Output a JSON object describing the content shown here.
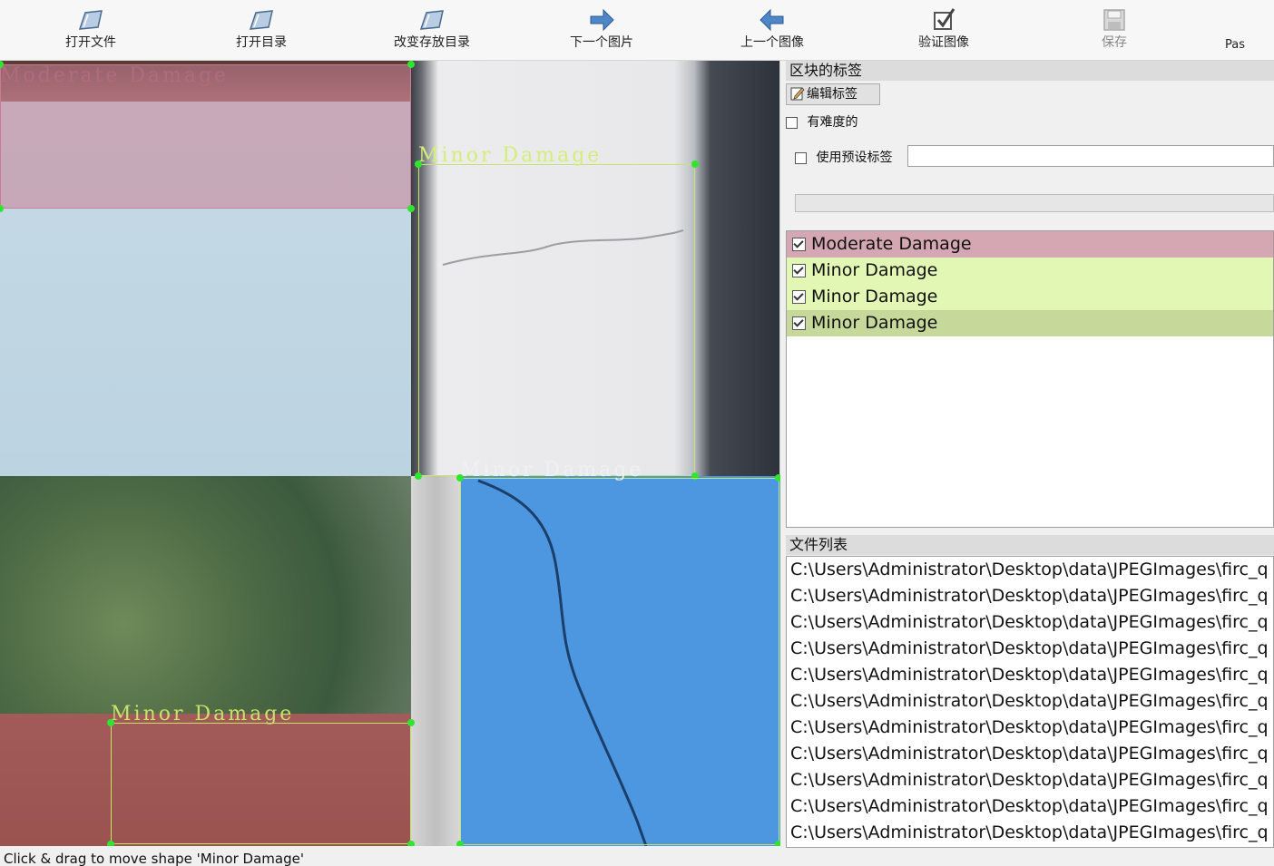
{
  "toolbar": {
    "open_file": "打开文件",
    "open_dir": "打开目录",
    "change_save_dir": "改变存放目录",
    "next_image": "下一个图片",
    "prev_image": "上一个图像",
    "verify_image": "验证图像",
    "save": "保存",
    "pascal": "Pas"
  },
  "annotations": {
    "box1": "Moderate Damage",
    "box2": "Minor Damage",
    "box3": "Minor Damage",
    "box4": "Minor Damage"
  },
  "panel": {
    "box_labels_title": "区块的标签",
    "edit_label": "编辑标签",
    "difficult": "有难度的",
    "use_default_label": "使用预设标签",
    "default_label_value": "",
    "file_list_title": "文件列表"
  },
  "labels": [
    {
      "text": "Moderate Damage",
      "checked": true,
      "color": "#d4a7b3"
    },
    {
      "text": "Minor Damage",
      "checked": true,
      "color": "#e3f7b4"
    },
    {
      "text": "Minor Damage",
      "checked": true,
      "color": "#e3f7b4"
    },
    {
      "text": "Minor Damage",
      "checked": true,
      "color": "#c6d99a"
    }
  ],
  "files": [
    "C:\\Users\\Administrator\\Desktop\\data\\JPEGImages\\firc_q",
    "C:\\Users\\Administrator\\Desktop\\data\\JPEGImages\\firc_q",
    "C:\\Users\\Administrator\\Desktop\\data\\JPEGImages\\firc_q",
    "C:\\Users\\Administrator\\Desktop\\data\\JPEGImages\\firc_q",
    "C:\\Users\\Administrator\\Desktop\\data\\JPEGImages\\firc_q",
    "C:\\Users\\Administrator\\Desktop\\data\\JPEGImages\\firc_q",
    "C:\\Users\\Administrator\\Desktop\\data\\JPEGImages\\firc_q",
    "C:\\Users\\Administrator\\Desktop\\data\\JPEGImages\\firc_q",
    "C:\\Users\\Administrator\\Desktop\\data\\JPEGImages\\firc_q",
    "C:\\Users\\Administrator\\Desktop\\data\\JPEGImages\\firc_q",
    "C:\\Users\\Administrator\\Desktop\\data\\JPEGImages\\firc_q"
  ],
  "status": "Click & drag to move shape 'Minor Damage'"
}
